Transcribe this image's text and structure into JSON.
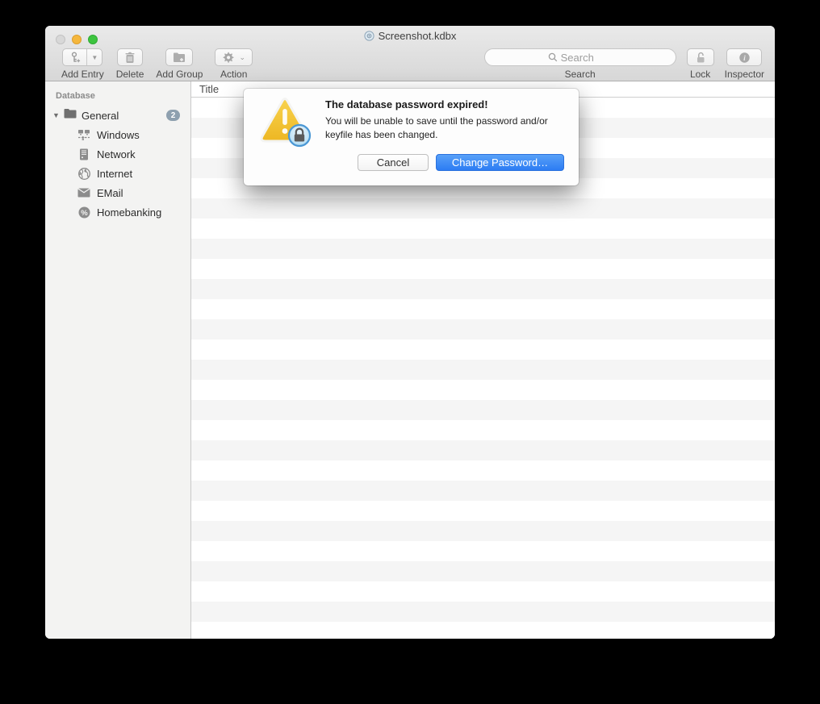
{
  "titlebar": {
    "title": "Screenshot.kdbx"
  },
  "toolbar": {
    "add_entry_label": "Add Entry",
    "delete_label": "Delete",
    "add_group_label": "Add Group",
    "action_label": "Action",
    "search_placeholder": "Search",
    "search_label": "Search",
    "lock_label": "Lock",
    "inspector_label": "Inspector"
  },
  "sidebar": {
    "section_header": "Database",
    "group": {
      "label": "General",
      "badge": "2"
    },
    "items": [
      {
        "label": "Windows",
        "icon": "windows-network-icon"
      },
      {
        "label": "Network",
        "icon": "server-icon"
      },
      {
        "label": "Internet",
        "icon": "globe-icon"
      },
      {
        "label": "EMail",
        "icon": "envelope-icon"
      },
      {
        "label": "Homebanking",
        "icon": "percent-circle-icon"
      }
    ]
  },
  "list": {
    "columns": [
      {
        "label": "Title"
      }
    ]
  },
  "dialog": {
    "title": "The database password expired!",
    "body": "You will be unable to save until the password and/or keyfile has been changed.",
    "buttons": {
      "cancel": "Cancel",
      "confirm": "Change Password…"
    }
  },
  "colors": {
    "confirm_blue": "#3d8df5",
    "warning_yellow": "#f2c237",
    "badge_gray_blue": "#8ea0af",
    "traffic_minimize": "#f5b73c",
    "traffic_zoom": "#3dc43f",
    "traffic_close_disabled": "#d8d8d8"
  }
}
